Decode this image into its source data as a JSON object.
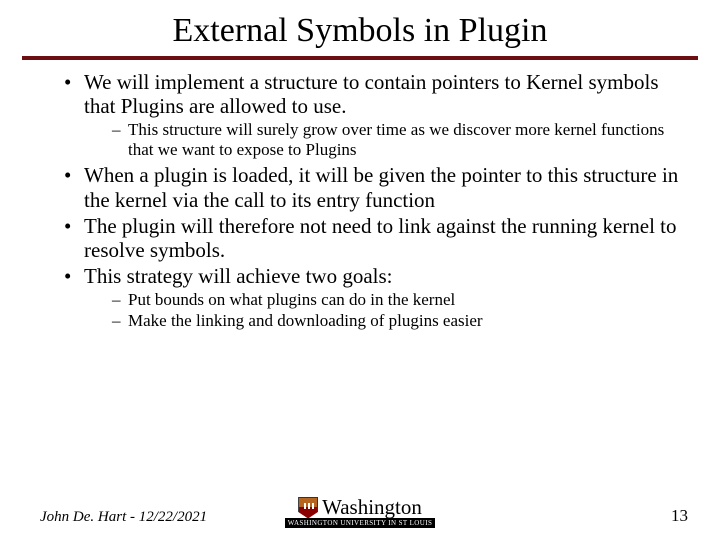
{
  "title": "External Symbols in Plugin",
  "bullets": {
    "b0": "We will implement a structure to contain pointers to Kernel symbols that Plugins are allowed to use.",
    "b0s0": "This structure will surely grow over time as we discover more kernel functions that we want to expose to Plugins",
    "b1": "When a plugin is loaded, it will be given the pointer to this structure in the kernel via the call to its entry function",
    "b2": "The plugin will therefore not need to link against the running kernel to resolve symbols.",
    "b3": "This strategy will achieve two goals:",
    "b3s0": "Put bounds on what plugins can do in the kernel",
    "b3s1": "Make the linking and downloading of plugins easier"
  },
  "footer": {
    "author_date": "John De. Hart - 12/22/2021",
    "uni_name": "Washington",
    "uni_sub": "WASHINGTON UNIVERSITY IN ST LOUIS",
    "page": "13"
  }
}
